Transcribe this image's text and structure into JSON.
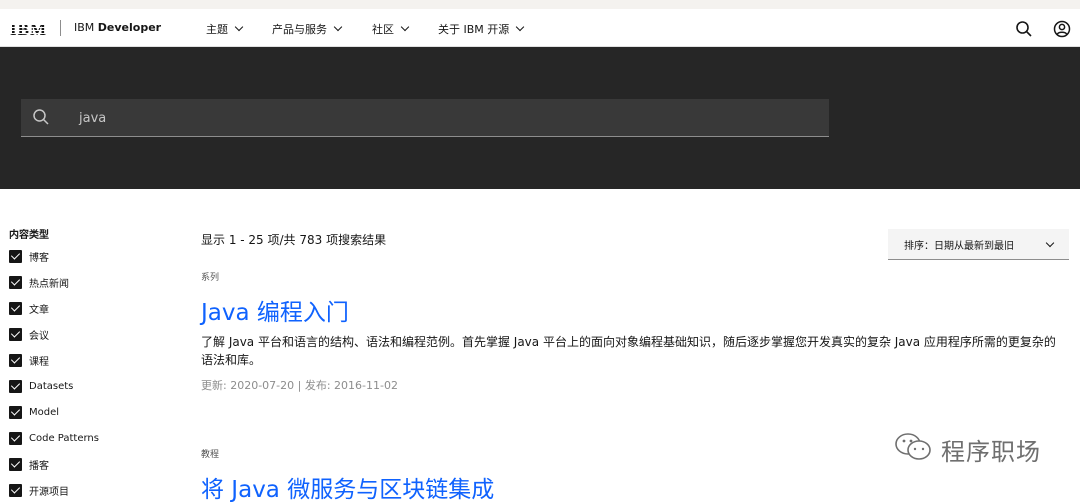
{
  "header": {
    "logo": "IBM",
    "brand_prefix": "IBM",
    "brand_name": "Developer",
    "menu": [
      {
        "label": "主题"
      },
      {
        "label": "产品与服务"
      },
      {
        "label": "社区"
      },
      {
        "label": "关于 IBM 开源"
      }
    ],
    "search_icon": "search-icon",
    "user_icon": "user-icon"
  },
  "search": {
    "value": "java"
  },
  "filters": {
    "title": "内容类型",
    "items": [
      {
        "label": "博客",
        "checked": true
      },
      {
        "label": "热点新闻",
        "checked": true
      },
      {
        "label": "文章",
        "checked": true
      },
      {
        "label": "会议",
        "checked": true
      },
      {
        "label": "课程",
        "checked": true
      },
      {
        "label": "Datasets",
        "checked": true
      },
      {
        "label": "Model",
        "checked": true
      },
      {
        "label": "Code Patterns",
        "checked": true
      },
      {
        "label": "播客",
        "checked": true
      },
      {
        "label": "开源项目",
        "checked": true
      }
    ]
  },
  "results": {
    "count_text": "显示 1 - 25 项/共 783 项搜索结果",
    "sort_label": "排序：日期从最新到最旧",
    "items": [
      {
        "type": "系列",
        "title": "Java 编程入门",
        "description": "了解 Java 平台和语言的结构、语法和编程范例。首先掌握 Java 平台上的面向对象编程基础知识，随后逐步掌握您开发真实的复杂 Java 应用程序所需的更复杂的语法和库。",
        "meta": "更新: 2020-07-20 | 发布: 2016-11-02"
      },
      {
        "type": "教程",
        "title": "将 Java 微服务与区块链集成"
      }
    ]
  },
  "watermark": {
    "text": "程序职场"
  },
  "colors": {
    "hero_bg": "#262626",
    "search_bg": "#393939",
    "link_blue": "#0f62fe"
  }
}
